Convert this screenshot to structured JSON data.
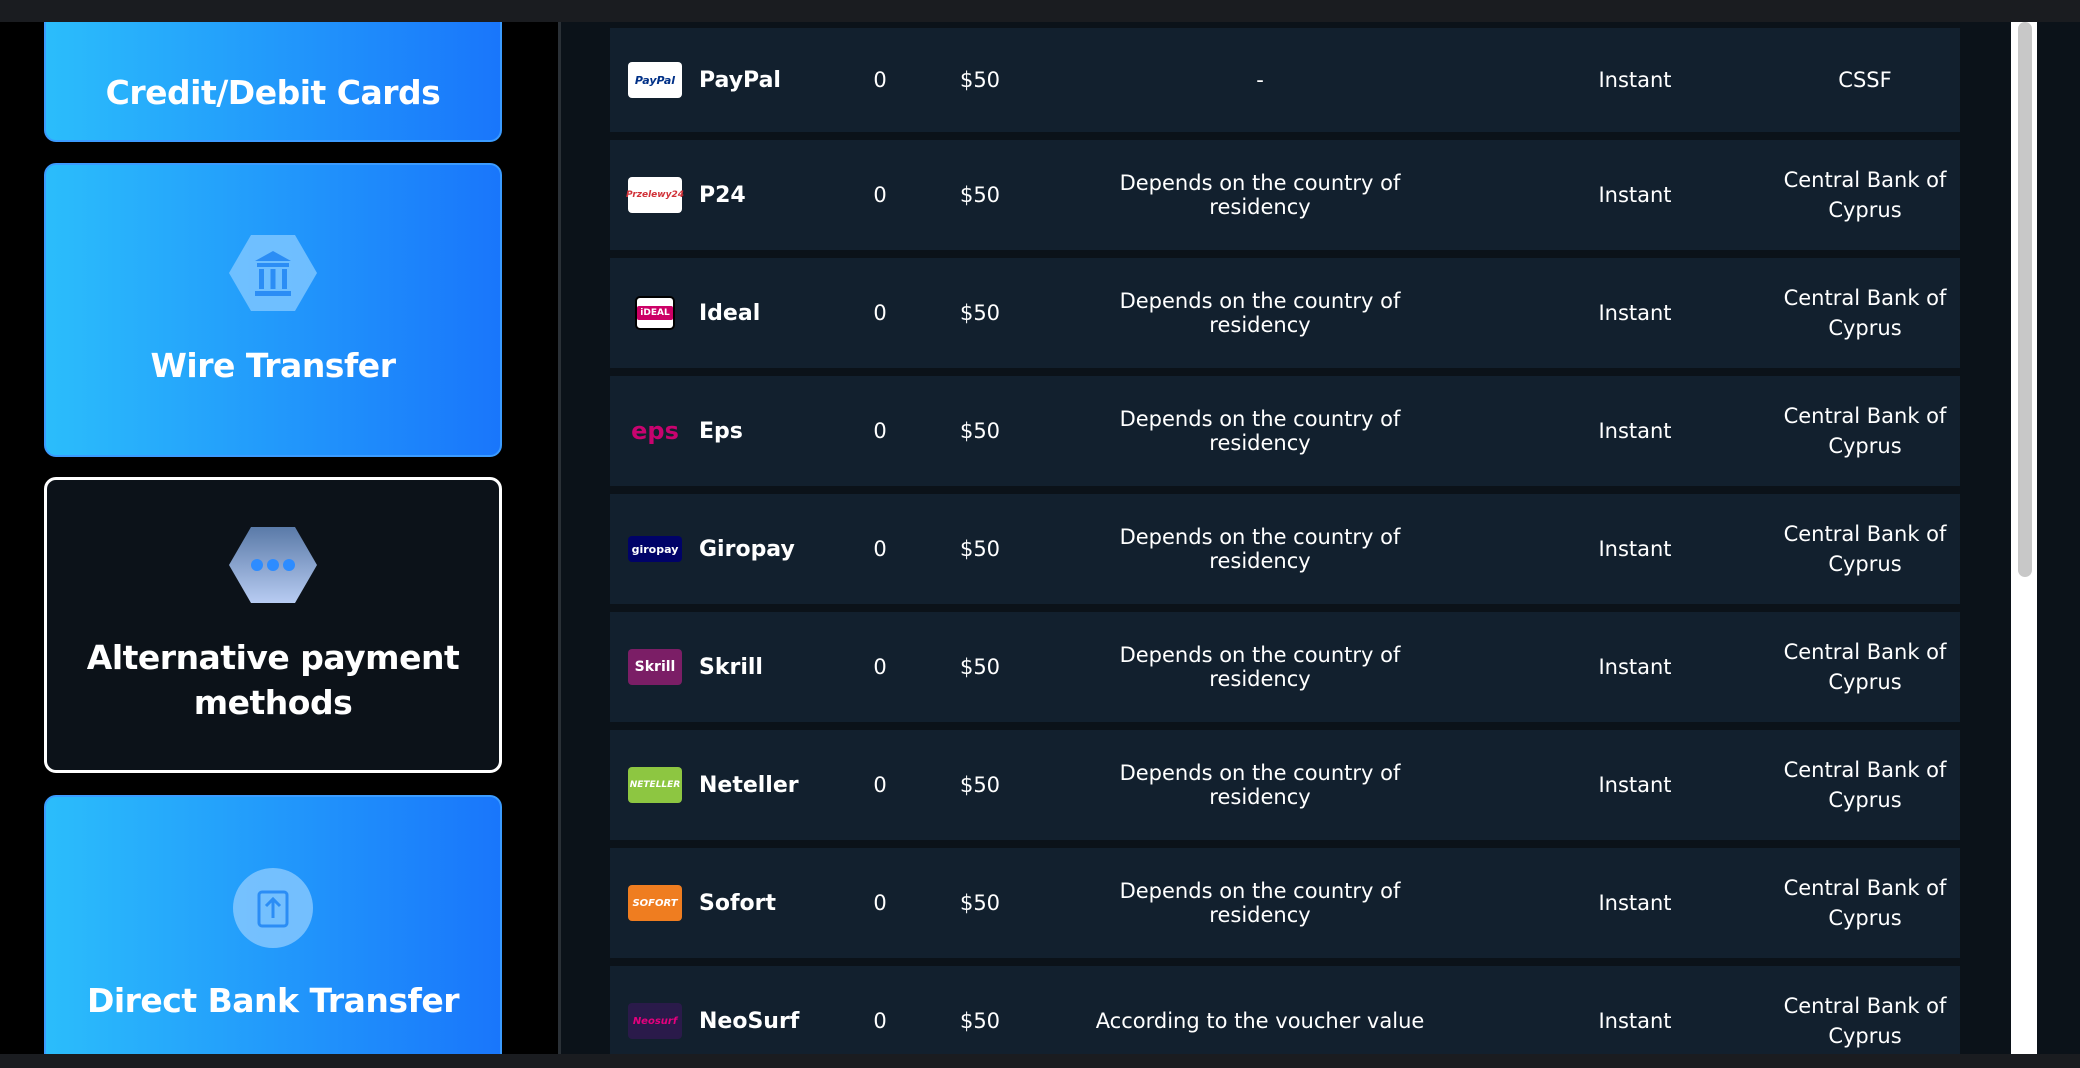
{
  "method_cards": [
    {
      "label": "Credit/Debit Cards",
      "icon": "card-icon"
    },
    {
      "label": "Wire Transfer",
      "icon": "bank-icon"
    },
    {
      "label": "Alternative payment methods",
      "icon": "more-dots-icon"
    },
    {
      "label": "Direct Bank Transfer",
      "icon": "bank-upload-icon"
    }
  ],
  "rows": [
    {
      "name": "PayPal",
      "logo_text": "PayPal",
      "min": "0",
      "max": "$50",
      "fee": "-",
      "time": "Instant",
      "regulator": "CSSF"
    },
    {
      "name": "P24",
      "logo_text": "Przelewy24",
      "min": "0",
      "max": "$50",
      "fee": "Depends on the country of residency",
      "time": "Instant",
      "regulator": "Central Bank of Cyprus"
    },
    {
      "name": "Ideal",
      "logo_text": "iDEAL",
      "min": "0",
      "max": "$50",
      "fee": "Depends on the country of residency",
      "time": "Instant",
      "regulator": "Central Bank of Cyprus"
    },
    {
      "name": "Eps",
      "logo_text": "eps",
      "min": "0",
      "max": "$50",
      "fee": "Depends on the country of residency",
      "time": "Instant",
      "regulator": "Central Bank of Cyprus"
    },
    {
      "name": "Giropay",
      "logo_text": "giropay",
      "min": "0",
      "max": "$50",
      "fee": "Depends on the country of residency",
      "time": "Instant",
      "regulator": "Central Bank of Cyprus"
    },
    {
      "name": "Skrill",
      "logo_text": "Skrill",
      "min": "0",
      "max": "$50",
      "fee": "Depends on the country of residency",
      "time": "Instant",
      "regulator": "Central Bank of Cyprus"
    },
    {
      "name": "Neteller",
      "logo_text": "NETELLER",
      "min": "0",
      "max": "$50",
      "fee": "Depends on the country of residency",
      "time": "Instant",
      "regulator": "Central Bank of Cyprus"
    },
    {
      "name": "Sofort",
      "logo_text": "SOFORT",
      "min": "0",
      "max": "$50",
      "fee": "Depends on the country of residency",
      "time": "Instant",
      "regulator": "Central Bank of Cyprus"
    },
    {
      "name": "NeoSurf",
      "logo_text": "Neosurf",
      "min": "0",
      "max": "$50",
      "fee": "According to the voucher value",
      "time": "Instant",
      "regulator": "Central Bank of Cyprus"
    }
  ],
  "colors": {
    "card_gradient_start": "#2bbdfb",
    "card_gradient_end": "#1976fb",
    "row_bg": "#12202e",
    "page_bg": "#0b1219"
  }
}
